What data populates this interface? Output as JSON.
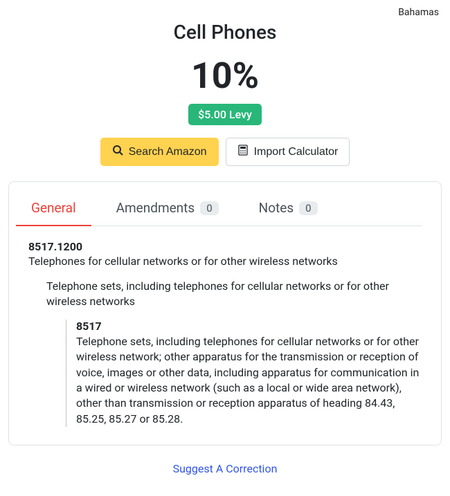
{
  "country": "Bahamas",
  "title": "Cell Phones",
  "percentage": "10%",
  "levy": "$5.00 Levy",
  "buttons": {
    "amazon": "Search Amazon",
    "calculator": "Import Calculator"
  },
  "tabs": {
    "general": "General",
    "amendments": {
      "label": "Amendments",
      "count": "0"
    },
    "notes": {
      "label": "Notes",
      "count": "0"
    }
  },
  "detail": {
    "code": "8517.1200",
    "desc": "Telephones for cellular networks or for other wireless networks",
    "level1": "Telephone sets, including telephones for cellular networks or for other wireless networks",
    "subCode": "8517",
    "subDesc": "Telephone sets, including telephones for cellular networks or for other wireless network; other apparatus for the transmission or reception of voice, images or other data, including apparatus for communication in a wired or wireless network (such as a local or wide area network), other than transmission or reception apparatus of heading 84.43, 85.25, 85.27 or 85.28."
  },
  "suggest": "Suggest A Correction"
}
